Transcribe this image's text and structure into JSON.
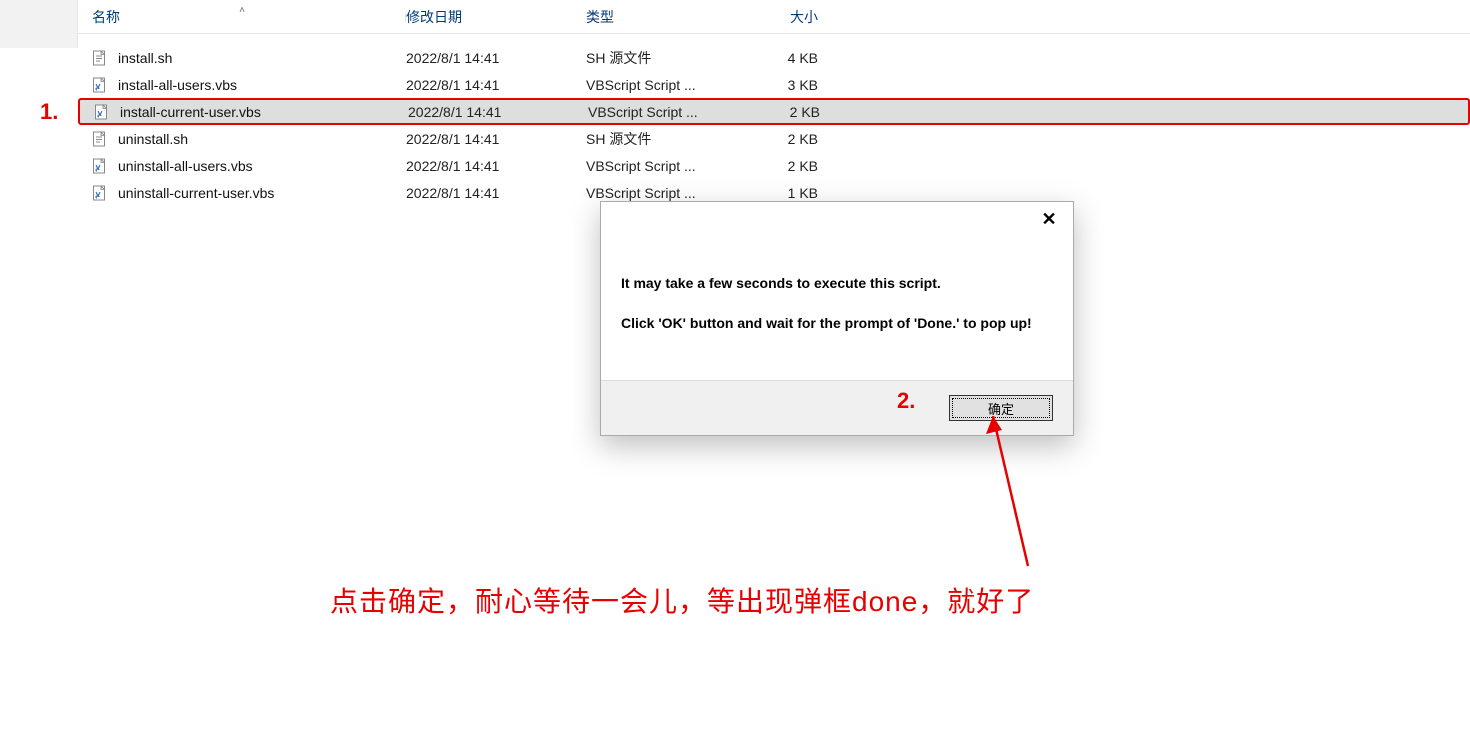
{
  "headers": {
    "name": "名称",
    "date": "修改日期",
    "type": "类型",
    "size": "大小"
  },
  "files": [
    {
      "name": "install.sh",
      "date": "2022/8/1 14:41",
      "type": "SH 源文件",
      "size": "4 KB",
      "icon": "sh"
    },
    {
      "name": "install-all-users.vbs",
      "date": "2022/8/1 14:41",
      "type": "VBScript Script ...",
      "size": "3 KB",
      "icon": "vbs"
    },
    {
      "name": "install-current-user.vbs",
      "date": "2022/8/1 14:41",
      "type": "VBScript Script ...",
      "size": "2 KB",
      "icon": "vbs"
    },
    {
      "name": "uninstall.sh",
      "date": "2022/8/1 14:41",
      "type": "SH 源文件",
      "size": "2 KB",
      "icon": "sh"
    },
    {
      "name": "uninstall-all-users.vbs",
      "date": "2022/8/1 14:41",
      "type": "VBScript Script ...",
      "size": "2 KB",
      "icon": "vbs"
    },
    {
      "name": "uninstall-current-user.vbs",
      "date": "2022/8/1 14:41",
      "type": "VBScript Script ...",
      "size": "1 KB",
      "icon": "vbs"
    }
  ],
  "highlighted_index": 2,
  "annotations": {
    "step1": "1.",
    "step2": "2.",
    "caption": "点击确定，耐心等待一会儿，等出现弹框done，就好了"
  },
  "dialog": {
    "line1": "It may take a few seconds to execute this script.",
    "line2": "Click 'OK' button and wait for the prompt of 'Done.' to pop up!",
    "ok_label": "确定"
  }
}
